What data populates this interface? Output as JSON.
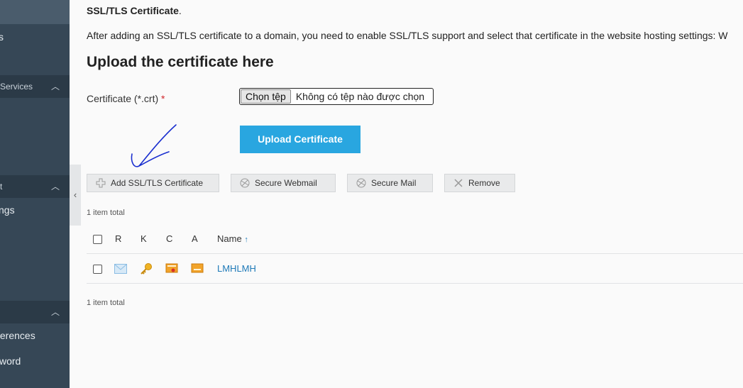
{
  "sidebar": {
    "items": [
      {
        "label": "s"
      },
      {
        "label": "ngs"
      },
      {
        "label": "ferences"
      },
      {
        "label": "word"
      }
    ],
    "sections": [
      {
        "label": "Services"
      },
      {
        "label": "t"
      },
      {
        "label": ""
      }
    ]
  },
  "intro": {
    "cert_bold": "SSL/TLS Certificate",
    "cert_tail": ".",
    "after_text": "After adding an SSL/TLS certificate to a domain, you need to enable SSL/TLS support and select that certificate in the website hosting settings: W"
  },
  "upload": {
    "title": "Upload the certificate here",
    "cert_label": "Certificate (*.crt)",
    "required_mark": "*",
    "file_button": "Chọn tệp",
    "file_status": "Không có tệp nào được chọn",
    "submit": "Upload Certificate"
  },
  "toolbar": {
    "add": "Add SSL/TLS Certificate",
    "secure_webmail": "Secure Webmail",
    "secure_mail": "Secure Mail",
    "remove": "Remove"
  },
  "list": {
    "count_top": "1 item total",
    "count_bottom": "1 item total",
    "headers": {
      "r": "R",
      "k": "K",
      "c": "C",
      "a": "A",
      "name": "Name",
      "sort_arrow": "↑"
    },
    "rows": [
      {
        "name": "LMHLMH"
      }
    ]
  },
  "colors": {
    "primary": "#29a6e0",
    "link": "#1f7ab8",
    "sidebar": "#364756"
  },
  "icons": [
    "plus-icon",
    "globe-icon",
    "close-icon",
    "mail-icon",
    "key-icon",
    "certificate-icon",
    "ca-certificate-icon",
    "arrow-up-icon",
    "chevron-up-icon",
    "chevron-left-icon"
  ]
}
